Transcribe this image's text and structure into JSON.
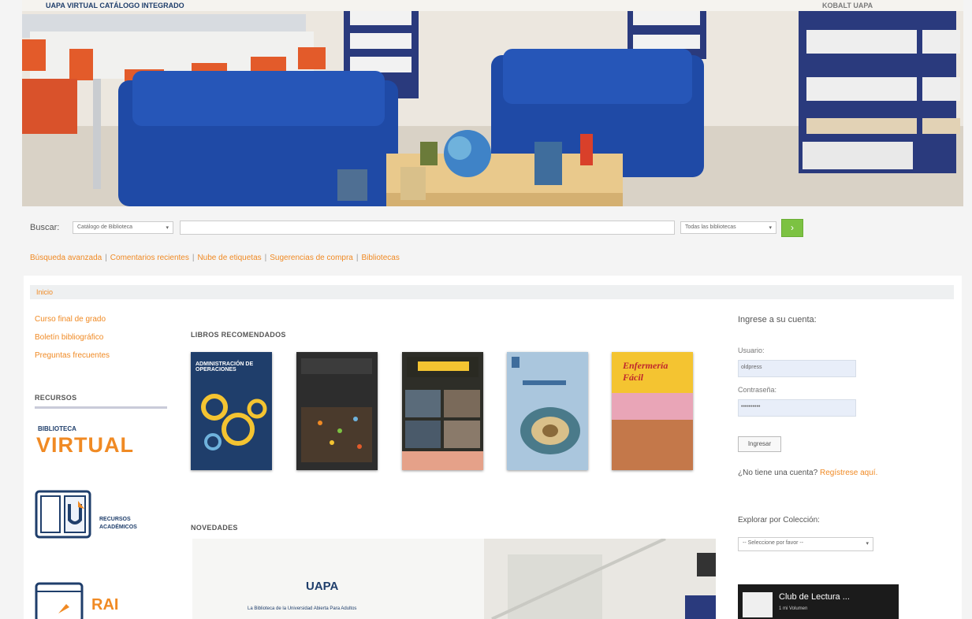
{
  "hero": {
    "logos": {
      "left": "UAPA  VIRTUAL  CATÁLOGO INTEGRADO",
      "right": "KOBALT  UAPA"
    }
  },
  "search": {
    "label": "Buscar:",
    "catalog_select": "Catálogo de Biblioteca",
    "library_select": "Todas las bibliotecas",
    "go_button": "›"
  },
  "links": [
    "Búsqueda avanzada",
    "Comentarios recientes",
    "Nube de etiquetas",
    "Sugerencias de compra",
    "Bibliotecas"
  ],
  "breadcrumb": {
    "home": "Inicio"
  },
  "sidebar": {
    "items": [
      "Curso final de grado",
      "Boletín bibliográfico",
      "Preguntas frecuentes"
    ],
    "resources_title": "RECURSOS",
    "bv_small": "BIBLIOTECA",
    "bv_big": "VIRTUAL",
    "ra_line1": "RECURSOS",
    "ra_line2": "ACADÉMICOS",
    "rai": "RAI"
  },
  "content": {
    "recommended_title": "LIBROS RECOMENDADOS",
    "news_title": "NOVEDADES",
    "news_logo": "UAPA",
    "news_caption": "La Biblioteca de la Universidad Abierta Para Adultos"
  },
  "books": [
    {
      "title": "ADMINISTRACIÓN DE OPERACIONES",
      "color": "#1f3e6b"
    },
    {
      "title": "",
      "color": "#3a3a3a"
    },
    {
      "title": "",
      "color": "#2e2e28"
    },
    {
      "title": "",
      "color": "#aac6dd"
    },
    {
      "title": "Enfermería Fácil",
      "color": "#f4c431"
    }
  ],
  "login": {
    "title": "Ingrese a su cuenta:",
    "user_label": "Usuario:",
    "user_value": "oldpress",
    "password_label": "Contraseña:",
    "password_value": "••••••••••",
    "button": "Ingresar",
    "no_account": "¿No tiene una cuenta?",
    "register": "Regístrese aquí."
  },
  "browse": {
    "title": "Explorar por Colección:",
    "select": "-- Seleccione por favor --"
  },
  "club": {
    "title": "Club de Lectura ...",
    "subtitle": "1 mi Volumen"
  },
  "colors": {
    "accent": "#f08a24",
    "go": "#7cc242",
    "dark_blue": "#1f3e6b"
  }
}
